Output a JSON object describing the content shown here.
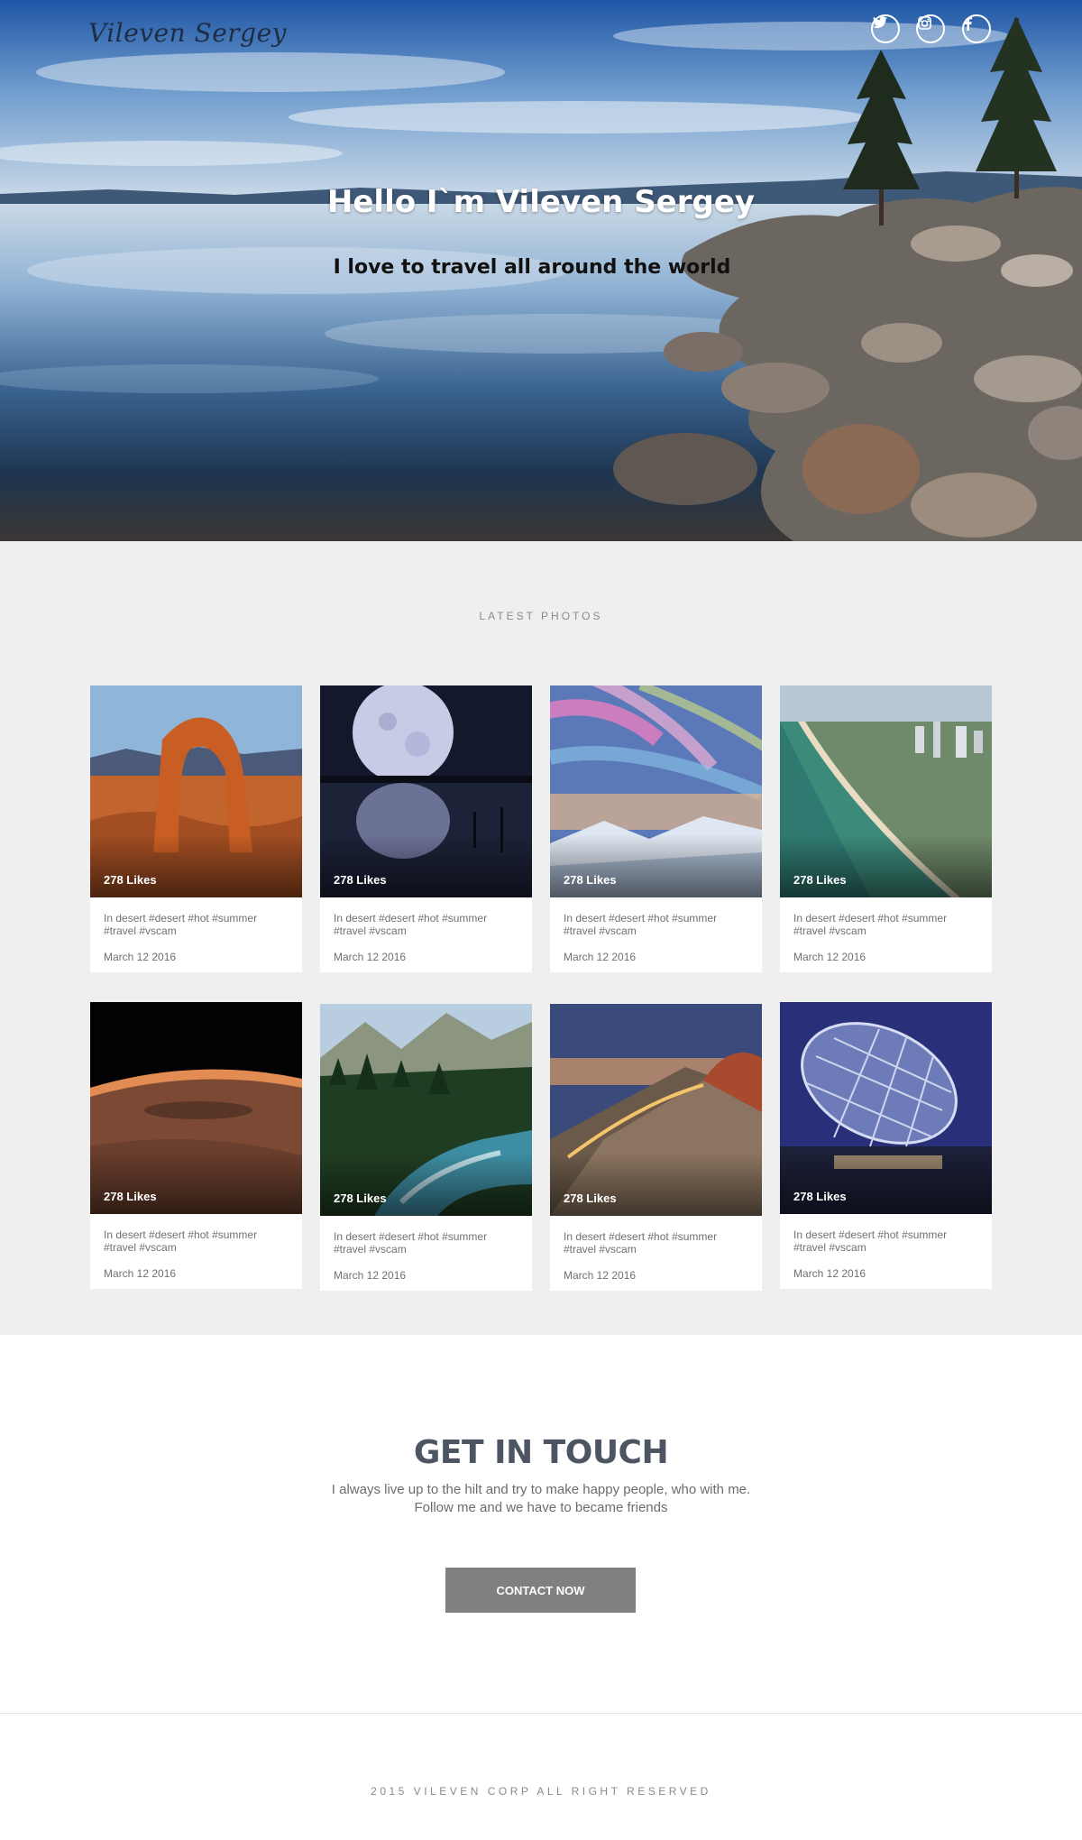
{
  "header": {
    "logo": "Vileven Sergey",
    "social": [
      {
        "icon": "twitter-icon"
      },
      {
        "icon": "instagram-icon"
      },
      {
        "icon": "facebook-icon"
      }
    ]
  },
  "hero": {
    "title": "Hello I`m Vileven Sergey",
    "subtitle": "I love to travel all around the world"
  },
  "photos": {
    "label": "LATEST PHOTOS",
    "items": [
      {
        "scene": "desert-arch",
        "likes": "278 Likes",
        "tags": "In desert #desert #hot #summer #travel #vscam",
        "date": "March 12 2016"
      },
      {
        "scene": "moon-lake",
        "likes": "278 Likes",
        "tags": "In desert #desert #hot #summer #travel #vscam",
        "date": "March 12 2016"
      },
      {
        "scene": "colorful-sky",
        "likes": "278 Likes",
        "tags": "In desert #desert #hot #summer #travel #vscam",
        "date": "March 12 2016"
      },
      {
        "scene": "coastline-city",
        "likes": "278 Likes",
        "tags": "In desert #desert #hot #summer #travel #vscam",
        "date": "March 12 2016"
      },
      {
        "scene": "planet-horizon",
        "likes": "278 Likes",
        "tags": "In desert #desert #hot #summer #travel #vscam",
        "date": "March 12 2016"
      },
      {
        "scene": "mountain-river",
        "likes": "278 Likes",
        "tags": "In desert #desert #hot #summer #travel #vscam",
        "date": "March 12 2016"
      },
      {
        "scene": "boardwalk-dusk",
        "likes": "278 Likes",
        "tags": "In desert #desert #hot #summer #travel #vscam",
        "date": "March 12 2016"
      },
      {
        "scene": "egg-building",
        "likes": "278 Likes",
        "tags": "In desert #desert #hot #summer #travel #vscam",
        "date": "March 12 2016"
      }
    ]
  },
  "contact": {
    "title": "GET IN TOUCH",
    "line1": "I always  live up to the hilt and try to make happy people, who with me.",
    "line2": "Follow me and we have to became friends",
    "button": "CONTACT NOW"
  },
  "footer": {
    "text": "2015 VILEVEN CORP ALL RIGHT RESERVED"
  },
  "colors": {
    "photos_bg": "#efefef",
    "button_bg": "#808080",
    "heading": "#4d5563"
  }
}
